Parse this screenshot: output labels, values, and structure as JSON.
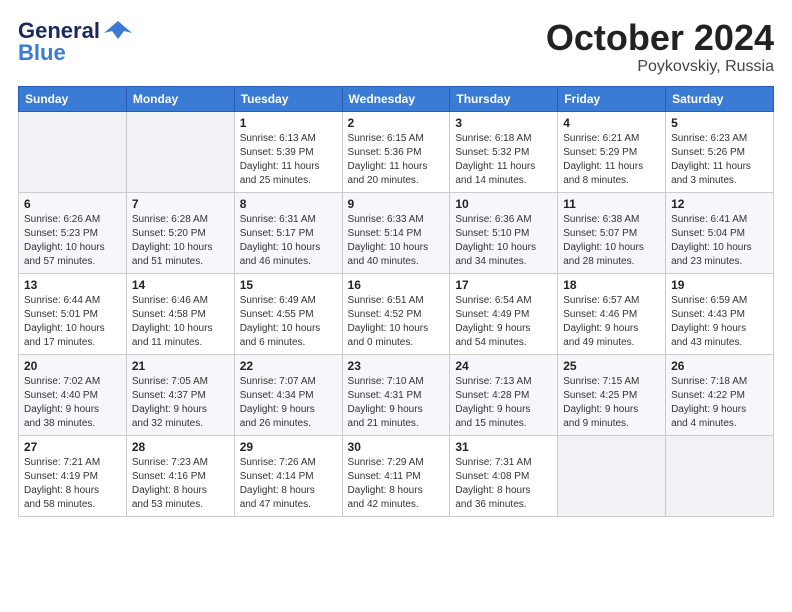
{
  "logo": {
    "line1": "General",
    "line2": "Blue"
  },
  "title": {
    "month": "October 2024",
    "location": "Poykovskiy, Russia"
  },
  "weekdays": [
    "Sunday",
    "Monday",
    "Tuesday",
    "Wednesday",
    "Thursday",
    "Friday",
    "Saturday"
  ],
  "weeks": [
    [
      {
        "day": "",
        "info": ""
      },
      {
        "day": "",
        "info": ""
      },
      {
        "day": "1",
        "info": "Sunrise: 6:13 AM\nSunset: 5:39 PM\nDaylight: 11 hours\nand 25 minutes."
      },
      {
        "day": "2",
        "info": "Sunrise: 6:15 AM\nSunset: 5:36 PM\nDaylight: 11 hours\nand 20 minutes."
      },
      {
        "day": "3",
        "info": "Sunrise: 6:18 AM\nSunset: 5:32 PM\nDaylight: 11 hours\nand 14 minutes."
      },
      {
        "day": "4",
        "info": "Sunrise: 6:21 AM\nSunset: 5:29 PM\nDaylight: 11 hours\nand 8 minutes."
      },
      {
        "day": "5",
        "info": "Sunrise: 6:23 AM\nSunset: 5:26 PM\nDaylight: 11 hours\nand 3 minutes."
      }
    ],
    [
      {
        "day": "6",
        "info": "Sunrise: 6:26 AM\nSunset: 5:23 PM\nDaylight: 10 hours\nand 57 minutes."
      },
      {
        "day": "7",
        "info": "Sunrise: 6:28 AM\nSunset: 5:20 PM\nDaylight: 10 hours\nand 51 minutes."
      },
      {
        "day": "8",
        "info": "Sunrise: 6:31 AM\nSunset: 5:17 PM\nDaylight: 10 hours\nand 46 minutes."
      },
      {
        "day": "9",
        "info": "Sunrise: 6:33 AM\nSunset: 5:14 PM\nDaylight: 10 hours\nand 40 minutes."
      },
      {
        "day": "10",
        "info": "Sunrise: 6:36 AM\nSunset: 5:10 PM\nDaylight: 10 hours\nand 34 minutes."
      },
      {
        "day": "11",
        "info": "Sunrise: 6:38 AM\nSunset: 5:07 PM\nDaylight: 10 hours\nand 28 minutes."
      },
      {
        "day": "12",
        "info": "Sunrise: 6:41 AM\nSunset: 5:04 PM\nDaylight: 10 hours\nand 23 minutes."
      }
    ],
    [
      {
        "day": "13",
        "info": "Sunrise: 6:44 AM\nSunset: 5:01 PM\nDaylight: 10 hours\nand 17 minutes."
      },
      {
        "day": "14",
        "info": "Sunrise: 6:46 AM\nSunset: 4:58 PM\nDaylight: 10 hours\nand 11 minutes."
      },
      {
        "day": "15",
        "info": "Sunrise: 6:49 AM\nSunset: 4:55 PM\nDaylight: 10 hours\nand 6 minutes."
      },
      {
        "day": "16",
        "info": "Sunrise: 6:51 AM\nSunset: 4:52 PM\nDaylight: 10 hours\nand 0 minutes."
      },
      {
        "day": "17",
        "info": "Sunrise: 6:54 AM\nSunset: 4:49 PM\nDaylight: 9 hours\nand 54 minutes."
      },
      {
        "day": "18",
        "info": "Sunrise: 6:57 AM\nSunset: 4:46 PM\nDaylight: 9 hours\nand 49 minutes."
      },
      {
        "day": "19",
        "info": "Sunrise: 6:59 AM\nSunset: 4:43 PM\nDaylight: 9 hours\nand 43 minutes."
      }
    ],
    [
      {
        "day": "20",
        "info": "Sunrise: 7:02 AM\nSunset: 4:40 PM\nDaylight: 9 hours\nand 38 minutes."
      },
      {
        "day": "21",
        "info": "Sunrise: 7:05 AM\nSunset: 4:37 PM\nDaylight: 9 hours\nand 32 minutes."
      },
      {
        "day": "22",
        "info": "Sunrise: 7:07 AM\nSunset: 4:34 PM\nDaylight: 9 hours\nand 26 minutes."
      },
      {
        "day": "23",
        "info": "Sunrise: 7:10 AM\nSunset: 4:31 PM\nDaylight: 9 hours\nand 21 minutes."
      },
      {
        "day": "24",
        "info": "Sunrise: 7:13 AM\nSunset: 4:28 PM\nDaylight: 9 hours\nand 15 minutes."
      },
      {
        "day": "25",
        "info": "Sunrise: 7:15 AM\nSunset: 4:25 PM\nDaylight: 9 hours\nand 9 minutes."
      },
      {
        "day": "26",
        "info": "Sunrise: 7:18 AM\nSunset: 4:22 PM\nDaylight: 9 hours\nand 4 minutes."
      }
    ],
    [
      {
        "day": "27",
        "info": "Sunrise: 7:21 AM\nSunset: 4:19 PM\nDaylight: 8 hours\nand 58 minutes."
      },
      {
        "day": "28",
        "info": "Sunrise: 7:23 AM\nSunset: 4:16 PM\nDaylight: 8 hours\nand 53 minutes."
      },
      {
        "day": "29",
        "info": "Sunrise: 7:26 AM\nSunset: 4:14 PM\nDaylight: 8 hours\nand 47 minutes."
      },
      {
        "day": "30",
        "info": "Sunrise: 7:29 AM\nSunset: 4:11 PM\nDaylight: 8 hours\nand 42 minutes."
      },
      {
        "day": "31",
        "info": "Sunrise: 7:31 AM\nSunset: 4:08 PM\nDaylight: 8 hours\nand 36 minutes."
      },
      {
        "day": "",
        "info": ""
      },
      {
        "day": "",
        "info": ""
      }
    ]
  ]
}
